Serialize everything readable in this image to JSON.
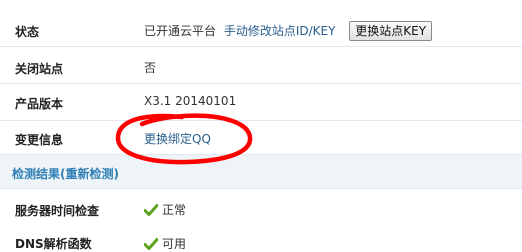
{
  "rows": {
    "status": {
      "label": "状态",
      "value_text": "已开通云平台",
      "link_text": "手动修改站点ID/KEY",
      "button_label": "更换站点KEY"
    },
    "close_site": {
      "label": "关闭站点",
      "value": "否"
    },
    "product_version": {
      "label": "产品版本",
      "value": "X3.1 20140101"
    },
    "change_info": {
      "label": "变更信息",
      "link_text": "更换绑定QQ"
    }
  },
  "section": {
    "title": "检测结果(重新检测)"
  },
  "checks": {
    "server_time": {
      "label": "服务器时间检查",
      "value": "正常",
      "icon": "check-icon",
      "icon_color": "#5aa51c"
    },
    "dns": {
      "label": "DNS解析函数",
      "value": "可用",
      "icon": "check-icon",
      "icon_color": "#5aa51c"
    }
  },
  "colors": {
    "link": "#2a5f8f",
    "section_title": "#2f7fb5",
    "section_bg": "#eef4f8",
    "annotation": "#ff0000"
  }
}
